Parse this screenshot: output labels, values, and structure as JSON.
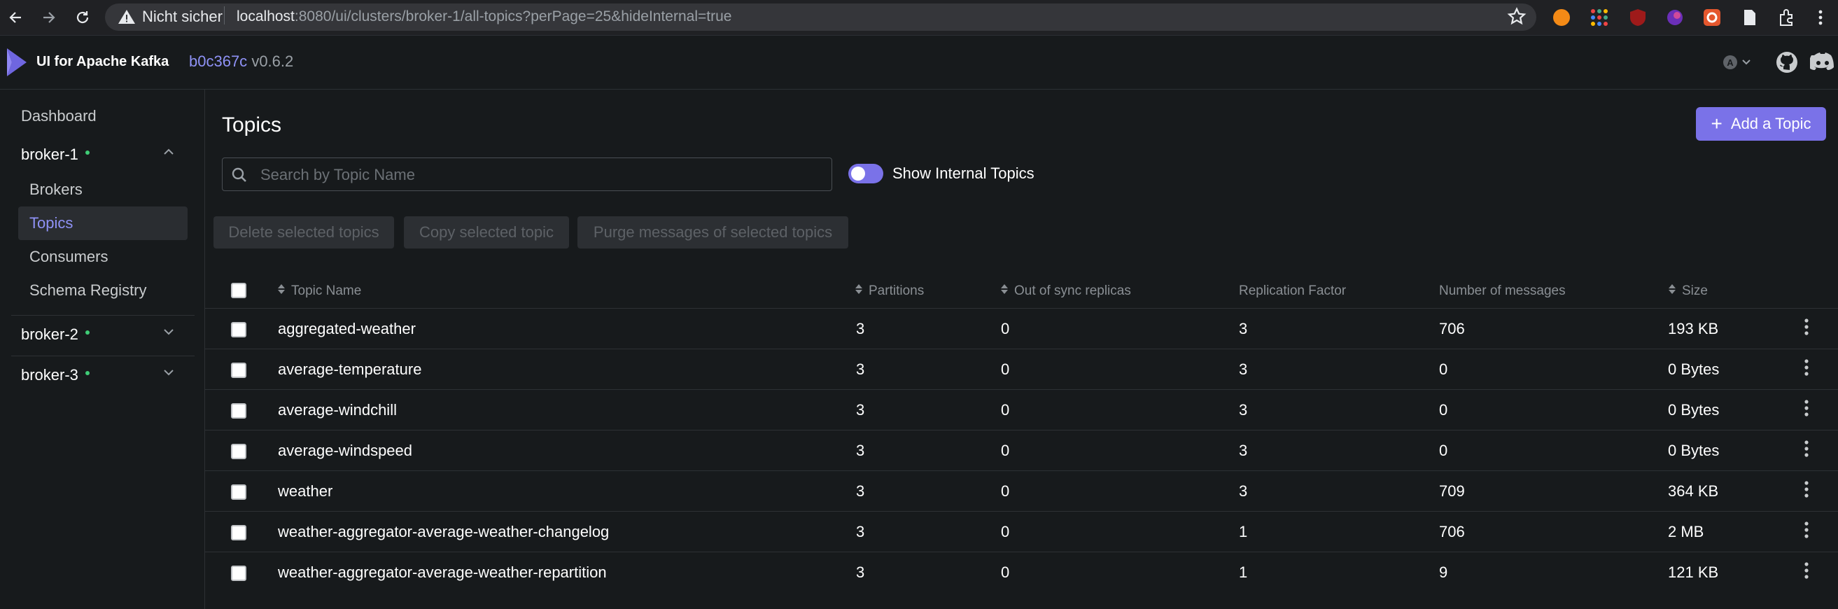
{
  "browser": {
    "insecure_label": "Nicht sicher",
    "url_host": "localhost",
    "url_rest": ":8080/ui/clusters/broker-1/all-topics?perPage=25&hideInternal=true"
  },
  "header": {
    "brand": "UI for Apache Kafka",
    "commit": "b0c367c",
    "version": "v0.6.2"
  },
  "sidebar": {
    "dashboard": "Dashboard",
    "clusters": [
      {
        "name": "broker-1",
        "expanded": true,
        "items": [
          "Brokers",
          "Topics",
          "Consumers",
          "Schema Registry"
        ],
        "active": "Topics"
      },
      {
        "name": "broker-2",
        "expanded": false
      },
      {
        "name": "broker-3",
        "expanded": false
      }
    ]
  },
  "main": {
    "title": "Topics",
    "add_button": "Add a Topic",
    "search_placeholder": "Search by Topic Name",
    "show_internal_label": "Show Internal Topics",
    "show_internal_on": true,
    "bulk_actions": [
      "Delete selected topics",
      "Copy selected topic",
      "Purge messages of selected topics"
    ],
    "columns": [
      "Topic Name",
      "Partitions",
      "Out of sync replicas",
      "Replication Factor",
      "Number of messages",
      "Size"
    ],
    "rows": [
      {
        "name": "aggregated-weather",
        "partitions": "3",
        "oos": "0",
        "rf": "3",
        "messages": "706",
        "size": "193 KB"
      },
      {
        "name": "average-temperature",
        "partitions": "3",
        "oos": "0",
        "rf": "3",
        "messages": "0",
        "size": "0 Bytes"
      },
      {
        "name": "average-windchill",
        "partitions": "3",
        "oos": "0",
        "rf": "3",
        "messages": "0",
        "size": "0 Bytes"
      },
      {
        "name": "average-windspeed",
        "partitions": "3",
        "oos": "0",
        "rf": "3",
        "messages": "0",
        "size": "0 Bytes"
      },
      {
        "name": "weather",
        "partitions": "3",
        "oos": "0",
        "rf": "3",
        "messages": "709",
        "size": "364 KB"
      },
      {
        "name": "weather-aggregator-average-weather-changelog",
        "partitions": "3",
        "oos": "0",
        "rf": "1",
        "messages": "706",
        "size": "2 MB"
      },
      {
        "name": "weather-aggregator-average-weather-repartition",
        "partitions": "3",
        "oos": "0",
        "rf": "1",
        "messages": "9",
        "size": "121 KB"
      }
    ]
  },
  "colors": {
    "accent": "#7a72e8",
    "status_ok": "#3fcc76",
    "bg": "#171a1c"
  }
}
